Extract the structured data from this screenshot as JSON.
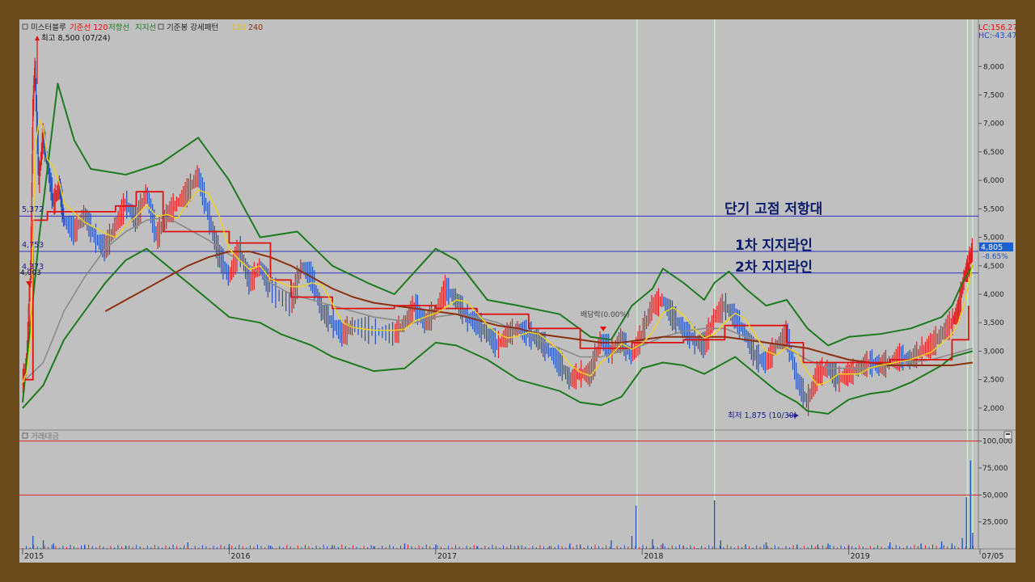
{
  "legend": {
    "box_icon": "square-icon",
    "stock_name": "미스터블루",
    "base_line": "기준선 120",
    "resistance": "저항선",
    "support": "지지선",
    "trend_box_icon": "square-icon",
    "trend_pattern": "기준봉 강세패턴",
    "ma120": "120",
    "ma240": "240"
  },
  "top_right": {
    "lc": "LC:156.27",
    "hc": "HC:-43.47"
  },
  "annotations": {
    "high": "최고 8,500 (07/24)",
    "low": "최저 1,875 (10/30)",
    "ex_rights": "배당락(0.00%)",
    "resistance_zone": "단기 고점 저항대",
    "support1": "1차 지지라인",
    "support2": "2차 지지라인"
  },
  "level_labels": [
    "5,372",
    "4,753",
    "4,373",
    "4,003"
  ],
  "current_price": {
    "value": "4,805",
    "change": "-8.65%"
  },
  "volume_panel": {
    "title": "거래대금",
    "box_icon": "square-icon",
    "corner_icon": "panel-resize-icon"
  },
  "colors": {
    "candle_up": "#e02020",
    "candle_down": "#2050c0",
    "envelope": "#1e7a1e",
    "base_line": "#e01010",
    "ma120": "#8a8a8a",
    "ma240": "#8b3010",
    "short_ma": "#f0d020",
    "horizontal_line": "#3030c0",
    "volume_ref_line": "#e02020",
    "marker_vline": "#c8f0c8",
    "background": "#c0c0c0"
  },
  "chart_data": {
    "type": "line",
    "title": "",
    "xlabel": "",
    "ylabel": "",
    "x_ticks": [
      "2015",
      "2016",
      "2017",
      "2018",
      "2019",
      "07/05"
    ],
    "price_axis": {
      "ylim": [
        1700,
        8600
      ],
      "ticks": [
        "2,000",
        "2,500",
        "3,000",
        "3,500",
        "4,000",
        "4,500",
        "5,000",
        "5,500",
        "6,000",
        "6,500",
        "7,000",
        "7,500",
        "8,000"
      ]
    },
    "volume_axis": {
      "ylim": [
        0,
        105000
      ],
      "ticks": [
        "25,000",
        "50,000",
        "75,000",
        "100,000"
      ]
    },
    "horizontal_levels": [
      5372,
      4753,
      4373
    ],
    "volume_reference_levels": [
      100000,
      50000
    ],
    "series": [
      {
        "name": "지지선",
        "values": []
      },
      {
        "name": "기준선 120",
        "values": []
      },
      {
        "name": "120",
        "values": []
      },
      {
        "name": "240",
        "values": []
      }
    ],
    "envelope_upper": [
      [
        2015.0,
        2100
      ],
      [
        2015.08,
        5000
      ],
      [
        2015.17,
        7700
      ],
      [
        2015.25,
        6700
      ],
      [
        2015.33,
        6200
      ],
      [
        2015.5,
        6100
      ],
      [
        2015.67,
        6300
      ],
      [
        2015.85,
        6750
      ],
      [
        2016.0,
        6000
      ],
      [
        2016.15,
        5000
      ],
      [
        2016.33,
        5100
      ],
      [
        2016.5,
        4500
      ],
      [
        2016.67,
        4200
      ],
      [
        2016.8,
        4000
      ],
      [
        2017.0,
        4800
      ],
      [
        2017.1,
        4600
      ],
      [
        2017.25,
        3900
      ],
      [
        2017.4,
        3800
      ],
      [
        2017.6,
        3650
      ],
      [
        2017.75,
        3250
      ],
      [
        2017.85,
        3200
      ],
      [
        2017.95,
        3800
      ],
      [
        2018.05,
        4100
      ],
      [
        2018.1,
        4450
      ],
      [
        2018.2,
        4200
      ],
      [
        2018.3,
        3900
      ],
      [
        2018.35,
        4200
      ],
      [
        2018.42,
        4400
      ],
      [
        2018.5,
        4100
      ],
      [
        2018.6,
        3800
      ],
      [
        2018.7,
        3900
      ],
      [
        2018.8,
        3400
      ],
      [
        2018.9,
        3100
      ],
      [
        2019.0,
        3250
      ],
      [
        2019.15,
        3300
      ],
      [
        2019.3,
        3400
      ],
      [
        2019.45,
        3600
      ],
      [
        2019.5,
        3800
      ],
      [
        2019.55,
        4200
      ],
      [
        2019.6,
        4500
      ]
    ],
    "envelope_lower": [
      [
        2015.0,
        2000
      ],
      [
        2015.1,
        2400
      ],
      [
        2015.2,
        3200
      ],
      [
        2015.3,
        3700
      ],
      [
        2015.4,
        4200
      ],
      [
        2015.5,
        4600
      ],
      [
        2015.6,
        4800
      ],
      [
        2015.7,
        4500
      ],
      [
        2015.9,
        3900
      ],
      [
        2016.0,
        3600
      ],
      [
        2016.15,
        3500
      ],
      [
        2016.25,
        3300
      ],
      [
        2016.4,
        3100
      ],
      [
        2016.5,
        2900
      ],
      [
        2016.7,
        2650
      ],
      [
        2016.85,
        2700
      ],
      [
        2017.0,
        3150
      ],
      [
        2017.1,
        3100
      ],
      [
        2017.25,
        2850
      ],
      [
        2017.4,
        2500
      ],
      [
        2017.6,
        2300
      ],
      [
        2017.7,
        2100
      ],
      [
        2017.8,
        2050
      ],
      [
        2017.9,
        2200
      ],
      [
        2018.0,
        2700
      ],
      [
        2018.1,
        2800
      ],
      [
        2018.2,
        2750
      ],
      [
        2018.3,
        2600
      ],
      [
        2018.35,
        2700
      ],
      [
        2018.45,
        2900
      ],
      [
        2018.55,
        2600
      ],
      [
        2018.65,
        2300
      ],
      [
        2018.75,
        2100
      ],
      [
        2018.8,
        1950
      ],
      [
        2018.9,
        1900
      ],
      [
        2019.0,
        2150
      ],
      [
        2019.1,
        2250
      ],
      [
        2019.2,
        2300
      ],
      [
        2019.3,
        2450
      ],
      [
        2019.45,
        2750
      ],
      [
        2019.5,
        2900
      ],
      [
        2019.6,
        3000
      ]
    ],
    "base_line_120": [
      [
        2015.0,
        2500
      ],
      [
        2015.05,
        2500
      ],
      [
        2015.05,
        5300
      ],
      [
        2015.12,
        5300
      ],
      [
        2015.12,
        5450
      ],
      [
        2015.45,
        5450
      ],
      [
        2015.45,
        5550
      ],
      [
        2015.55,
        5550
      ],
      [
        2015.55,
        5800
      ],
      [
        2015.68,
        5800
      ],
      [
        2015.68,
        5100
      ],
      [
        2016.0,
        5100
      ],
      [
        2016.0,
        4900
      ],
      [
        2016.2,
        4900
      ],
      [
        2016.2,
        4250
      ],
      [
        2016.3,
        4250
      ],
      [
        2016.3,
        3950
      ],
      [
        2016.5,
        3950
      ],
      [
        2016.5,
        3750
      ],
      [
        2016.8,
        3750
      ],
      [
        2016.8,
        3800
      ],
      [
        2017.0,
        3800
      ],
      [
        2017.0,
        3750
      ],
      [
        2017.2,
        3750
      ],
      [
        2017.2,
        3650
      ],
      [
        2017.45,
        3650
      ],
      [
        2017.45,
        3400
      ],
      [
        2017.7,
        3400
      ],
      [
        2017.7,
        3050
      ],
      [
        2017.95,
        3050
      ],
      [
        2017.95,
        3150
      ],
      [
        2018.2,
        3150
      ],
      [
        2018.2,
        3200
      ],
      [
        2018.4,
        3200
      ],
      [
        2018.4,
        3450
      ],
      [
        2018.7,
        3450
      ],
      [
        2018.7,
        3150
      ],
      [
        2018.78,
        3150
      ],
      [
        2018.78,
        2800
      ],
      [
        2019.2,
        2800
      ],
      [
        2019.2,
        2850
      ],
      [
        2019.5,
        2850
      ],
      [
        2019.5,
        3200
      ],
      [
        2019.58,
        3200
      ],
      [
        2019.58,
        3800
      ]
    ],
    "ma120": [
      [
        2015.0,
        2450
      ],
      [
        2015.1,
        2800
      ],
      [
        2015.2,
        3700
      ],
      [
        2015.3,
        4300
      ],
      [
        2015.4,
        4800
      ],
      [
        2015.5,
        5100
      ],
      [
        2015.6,
        5300
      ],
      [
        2015.7,
        5350
      ],
      [
        2015.8,
        5150
      ],
      [
        2015.9,
        4950
      ],
      [
        2016.0,
        4700
      ],
      [
        2016.1,
        4500
      ],
      [
        2016.2,
        4200
      ],
      [
        2016.3,
        4000
      ],
      [
        2016.4,
        3900
      ],
      [
        2016.5,
        3800
      ],
      [
        2016.6,
        3700
      ],
      [
        2016.7,
        3600
      ],
      [
        2016.8,
        3550
      ],
      [
        2016.9,
        3500
      ],
      [
        2017.0,
        3600
      ],
      [
        2017.1,
        3650
      ],
      [
        2017.2,
        3600
      ],
      [
        2017.3,
        3500
      ],
      [
        2017.4,
        3350
      ],
      [
        2017.5,
        3200
      ],
      [
        2017.6,
        3050
      ],
      [
        2017.7,
        2900
      ],
      [
        2017.8,
        2900
      ],
      [
        2017.9,
        3000
      ],
      [
        2018.0,
        3100
      ],
      [
        2018.1,
        3250
      ],
      [
        2018.2,
        3350
      ],
      [
        2018.3,
        3400
      ],
      [
        2018.4,
        3400
      ],
      [
        2018.5,
        3250
      ],
      [
        2018.6,
        3150
      ],
      [
        2018.7,
        3050
      ],
      [
        2018.8,
        2850
      ],
      [
        2018.9,
        2700
      ],
      [
        2019.0,
        2700
      ],
      [
        2019.1,
        2700
      ],
      [
        2019.2,
        2750
      ],
      [
        2019.3,
        2800
      ],
      [
        2019.4,
        2850
      ],
      [
        2019.5,
        2950
      ],
      [
        2019.6,
        3050
      ]
    ],
    "ma240": [
      [
        2015.4,
        3700
      ],
      [
        2015.5,
        3900
      ],
      [
        2015.6,
        4100
      ],
      [
        2015.7,
        4300
      ],
      [
        2015.8,
        4500
      ],
      [
        2015.9,
        4650
      ],
      [
        2016.0,
        4750
      ],
      [
        2016.1,
        4750
      ],
      [
        2016.2,
        4650
      ],
      [
        2016.3,
        4500
      ],
      [
        2016.4,
        4300
      ],
      [
        2016.5,
        4100
      ],
      [
        2016.6,
        3950
      ],
      [
        2016.7,
        3850
      ],
      [
        2016.8,
        3800
      ],
      [
        2016.9,
        3750
      ],
      [
        2017.0,
        3700
      ],
      [
        2017.1,
        3650
      ],
      [
        2017.2,
        3550
      ],
      [
        2017.3,
        3450
      ],
      [
        2017.4,
        3400
      ],
      [
        2017.5,
        3300
      ],
      [
        2017.6,
        3250
      ],
      [
        2017.7,
        3200
      ],
      [
        2017.8,
        3150
      ],
      [
        2017.9,
        3150
      ],
      [
        2018.0,
        3200
      ],
      [
        2018.1,
        3250
      ],
      [
        2018.2,
        3250
      ],
      [
        2018.3,
        3250
      ],
      [
        2018.4,
        3250
      ],
      [
        2018.5,
        3200
      ],
      [
        2018.6,
        3150
      ],
      [
        2018.7,
        3100
      ],
      [
        2018.8,
        3050
      ],
      [
        2018.9,
        2950
      ],
      [
        2019.0,
        2850
      ],
      [
        2019.1,
        2800
      ],
      [
        2019.2,
        2750
      ],
      [
        2019.3,
        2750
      ],
      [
        2019.4,
        2750
      ],
      [
        2019.5,
        2750
      ],
      [
        2019.6,
        2800
      ]
    ],
    "price_trace": [
      [
        2015.0,
        2450
      ],
      [
        2015.02,
        2800
      ],
      [
        2015.04,
        4500
      ],
      [
        2015.05,
        7200
      ],
      [
        2015.06,
        8000
      ],
      [
        2015.08,
        6000
      ],
      [
        2015.1,
        6800
      ],
      [
        2015.12,
        6300
      ],
      [
        2015.15,
        5600
      ],
      [
        2015.18,
        5900
      ],
      [
        2015.2,
        5300
      ],
      [
        2015.25,
        5100
      ],
      [
        2015.3,
        5400
      ],
      [
        2015.35,
        5000
      ],
      [
        2015.4,
        4800
      ],
      [
        2015.45,
        5200
      ],
      [
        2015.5,
        5600
      ],
      [
        2015.55,
        5300
      ],
      [
        2015.6,
        5800
      ],
      [
        2015.65,
        5000
      ],
      [
        2015.7,
        5400
      ],
      [
        2015.75,
        5600
      ],
      [
        2015.8,
        5800
      ],
      [
        2015.85,
        6100
      ],
      [
        2015.9,
        5400
      ],
      [
        2015.95,
        4700
      ],
      [
        2016.0,
        4300
      ],
      [
        2016.05,
        4800
      ],
      [
        2016.1,
        4200
      ],
      [
        2016.15,
        4500
      ],
      [
        2016.2,
        4100
      ],
      [
        2016.3,
        3800
      ],
      [
        2016.35,
        4500
      ],
      [
        2016.4,
        4300
      ],
      [
        2016.45,
        3700
      ],
      [
        2016.5,
        3500
      ],
      [
        2016.55,
        3300
      ],
      [
        2016.6,
        3450
      ],
      [
        2016.7,
        3350
      ],
      [
        2016.8,
        3300
      ],
      [
        2016.85,
        3500
      ],
      [
        2016.9,
        3800
      ],
      [
        2016.95,
        3500
      ],
      [
        2017.0,
        3700
      ],
      [
        2017.05,
        4100
      ],
      [
        2017.1,
        3900
      ],
      [
        2017.15,
        3600
      ],
      [
        2017.2,
        3500
      ],
      [
        2017.25,
        3300
      ],
      [
        2017.3,
        3100
      ],
      [
        2017.35,
        3300
      ],
      [
        2017.4,
        3400
      ],
      [
        2017.45,
        3300
      ],
      [
        2017.5,
        3200
      ],
      [
        2017.55,
        3000
      ],
      [
        2017.6,
        2800
      ],
      [
        2017.65,
        2500
      ],
      [
        2017.7,
        2600
      ],
      [
        2017.75,
        2600
      ],
      [
        2017.8,
        3200
      ],
      [
        2017.85,
        3000
      ],
      [
        2017.9,
        3200
      ],
      [
        2017.95,
        2900
      ],
      [
        2018.0,
        3300
      ],
      [
        2018.05,
        3800
      ],
      [
        2018.1,
        3900
      ],
      [
        2018.15,
        3600
      ],
      [
        2018.2,
        3400
      ],
      [
        2018.25,
        3200
      ],
      [
        2018.3,
        3100
      ],
      [
        2018.35,
        3600
      ],
      [
        2018.4,
        3800
      ],
      [
        2018.45,
        3600
      ],
      [
        2018.5,
        3300
      ],
      [
        2018.55,
        2900
      ],
      [
        2018.6,
        2800
      ],
      [
        2018.65,
        3100
      ],
      [
        2018.7,
        3300
      ],
      [
        2018.75,
        2500
      ],
      [
        2018.8,
        2100
      ],
      [
        2018.85,
        2600
      ],
      [
        2018.9,
        2700
      ],
      [
        2018.95,
        2500
      ],
      [
        2019.0,
        2600
      ],
      [
        2019.05,
        2700
      ],
      [
        2019.1,
        2800
      ],
      [
        2019.15,
        2750
      ],
      [
        2019.2,
        2800
      ],
      [
        2019.25,
        2900
      ],
      [
        2019.3,
        2850
      ],
      [
        2019.35,
        3000
      ],
      [
        2019.4,
        3100
      ],
      [
        2019.45,
        3300
      ],
      [
        2019.5,
        3500
      ],
      [
        2019.53,
        3700
      ],
      [
        2019.56,
        4300
      ],
      [
        2019.58,
        4500
      ],
      [
        2019.6,
        4800
      ]
    ],
    "volume_spikes": [
      [
        2015.05,
        12000
      ],
      [
        2015.1,
        8000
      ],
      [
        2015.15,
        5000
      ],
      [
        2015.3,
        4000
      ],
      [
        2015.5,
        3000
      ],
      [
        2015.8,
        6000
      ],
      [
        2016.0,
        4500
      ],
      [
        2016.2,
        3000
      ],
      [
        2016.5,
        3500
      ],
      [
        2016.7,
        2500
      ],
      [
        2016.85,
        5000
      ],
      [
        2017.0,
        4000
      ],
      [
        2017.2,
        2500
      ],
      [
        2017.4,
        3000
      ],
      [
        2017.55,
        2500
      ],
      [
        2017.65,
        5000
      ],
      [
        2017.7,
        4000
      ],
      [
        2017.85,
        8000
      ],
      [
        2017.95,
        12000
      ],
      [
        2017.97,
        40000
      ],
      [
        2018.05,
        9000
      ],
      [
        2018.1,
        5000
      ],
      [
        2018.2,
        3000
      ],
      [
        2018.35,
        45000
      ],
      [
        2018.38,
        8000
      ],
      [
        2018.5,
        4000
      ],
      [
        2018.6,
        6000
      ],
      [
        2018.75,
        4000
      ],
      [
        2018.85,
        4000
      ],
      [
        2018.9,
        5000
      ],
      [
        2019.0,
        3000
      ],
      [
        2019.2,
        6000
      ],
      [
        2019.35,
        5000
      ],
      [
        2019.45,
        7000
      ],
      [
        2019.5,
        5000
      ],
      [
        2019.55,
        10000
      ],
      [
        2019.57,
        48000
      ],
      [
        2019.59,
        82000
      ],
      [
        2019.6,
        15000
      ]
    ]
  }
}
